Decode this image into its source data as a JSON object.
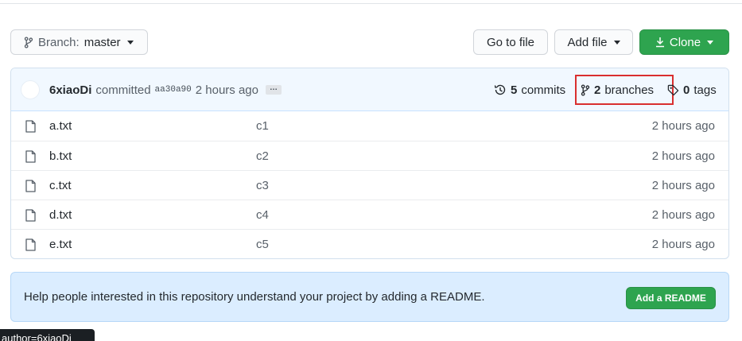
{
  "toolbar": {
    "branch_prefix": "Branch:",
    "branch_name": "master",
    "go_to_file": "Go to file",
    "add_file": "Add file",
    "clone": "Clone"
  },
  "commit": {
    "author": "6xiaoDi",
    "verb": "committed",
    "sha": "aa30a90",
    "time": "2 hours ago",
    "ellipsis": "…"
  },
  "stats": {
    "commits_count": "5",
    "commits_label": "commits",
    "branches_count": "2",
    "branches_label": "branches",
    "tags_count": "0",
    "tags_label": "tags"
  },
  "files": [
    {
      "name": "a.txt",
      "message": "c1",
      "time": "2 hours ago"
    },
    {
      "name": "b.txt",
      "message": "c2",
      "time": "2 hours ago"
    },
    {
      "name": "c.txt",
      "message": "c3",
      "time": "2 hours ago"
    },
    {
      "name": "d.txt",
      "message": "c4",
      "time": "2 hours ago"
    },
    {
      "name": "e.txt",
      "message": "c5",
      "time": "2 hours ago"
    }
  ],
  "readme": {
    "text": "Help people interested in this repository understand your project by adding a README.",
    "button": "Add a README"
  },
  "tooltip": {
    "text": "author=6xiaoDi"
  },
  "colors": {
    "primary_green": "#2ea44f",
    "highlight_red": "#d92f2f",
    "commit_bar_bg": "#f1f8ff",
    "readme_bg": "#dbedff"
  },
  "icons": {
    "branch": "git-branch-icon",
    "download": "download-icon",
    "history": "history-icon",
    "tag": "tag-icon",
    "file": "file-icon"
  }
}
